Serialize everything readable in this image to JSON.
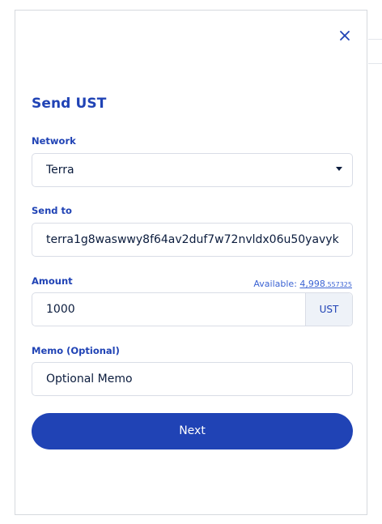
{
  "modal": {
    "title": "Send UST",
    "network": {
      "label": "Network",
      "value": "Terra"
    },
    "send_to": {
      "label": "Send to",
      "value": "terra1g8waswwy8f64av2duf7w72nvldx06u50yavyk"
    },
    "amount": {
      "label": "Amount",
      "available_label": "Available:",
      "available_main": "4,998",
      "available_decimals": ".557325",
      "value": "1000",
      "unit": "UST"
    },
    "memo": {
      "label": "Memo (Optional)",
      "placeholder": "Optional Memo"
    },
    "next_label": "Next"
  },
  "icons": {
    "close": "close-icon",
    "dropdown": "chevron-down-icon"
  },
  "colors": {
    "accent": "#2043b5",
    "link": "#3b63d3",
    "border": "#d9dde6",
    "unit_bg": "#eef2f8"
  }
}
